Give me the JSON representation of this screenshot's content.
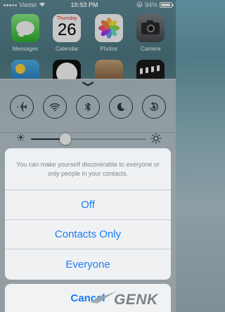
{
  "status_bar": {
    "carrier": "Viettel",
    "time": "10:53 PM",
    "battery": "94%",
    "battery_level": 0.94
  },
  "home_apps": [
    {
      "label": "Messages",
      "icon": "messages-icon"
    },
    {
      "label": "Calendar",
      "icon": "calendar-icon",
      "weekday": "Thursday",
      "date": "26"
    },
    {
      "label": "Photos",
      "icon": "photos-icon"
    },
    {
      "label": "Camera",
      "icon": "camera-icon"
    }
  ],
  "home_apps_row2": [
    "weather-icon",
    "clock-icon",
    "newsstand-icon",
    "videos-icon"
  ],
  "control_center": {
    "toggles": [
      {
        "name": "airplane-mode",
        "icon": "airplane-icon"
      },
      {
        "name": "wifi",
        "icon": "wifi-icon"
      },
      {
        "name": "bluetooth",
        "icon": "bluetooth-icon"
      },
      {
        "name": "do-not-disturb",
        "icon": "moon-icon"
      },
      {
        "name": "rotation-lock",
        "icon": "rotation-lock-icon"
      }
    ],
    "brightness_level": 0.3,
    "music_time_left": "--:--",
    "music_time_right": "--:--"
  },
  "action_sheet": {
    "message": "You can make yourself discoverable to everyone or only people in your contacts.",
    "options": [
      "Off",
      "Contacts Only",
      "Everyone"
    ],
    "cancel_label": "Cancel"
  },
  "watermark": {
    "text": "GENK"
  },
  "colors": {
    "accent": "#1a7cf5",
    "toggle_stroke": "#2c3a44",
    "message_text": "#7e858b"
  }
}
